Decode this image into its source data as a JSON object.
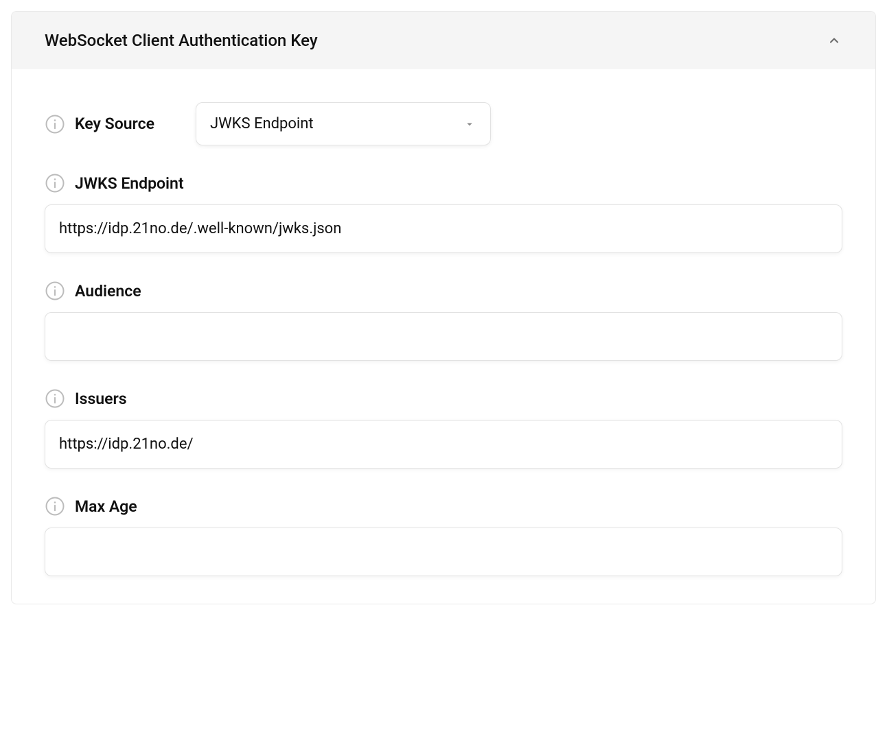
{
  "panel": {
    "title": "WebSocket Client Authentication Key"
  },
  "form": {
    "keySource": {
      "label": "Key Source",
      "value": "JWKS Endpoint"
    },
    "jwksEndpoint": {
      "label": "JWKS Endpoint",
      "value": "https://idp.21no.de/.well-known/jwks.json"
    },
    "audience": {
      "label": "Audience",
      "value": ""
    },
    "issuers": {
      "label": "Issuers",
      "value": "https://idp.21no.de/"
    },
    "maxAge": {
      "label": "Max Age",
      "value": ""
    }
  }
}
